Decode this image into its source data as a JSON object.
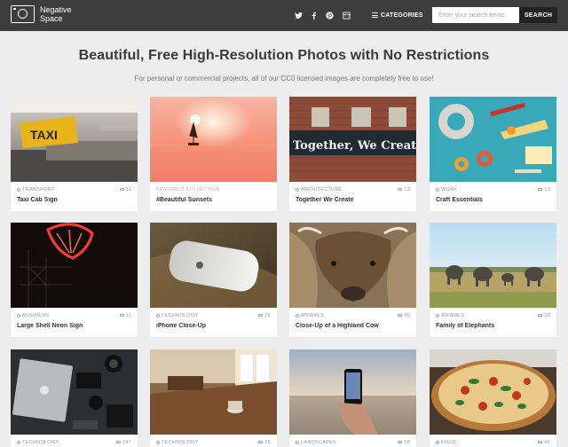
{
  "brand": {
    "name": "Negative Space"
  },
  "nav": {
    "social": [
      "twitter-icon",
      "facebook-icon",
      "pinterest-icon",
      "instagram-icon"
    ],
    "categories_label": "CATEGORIES",
    "search_placeholder": "Enter your search terms",
    "search_button": "SEARCH"
  },
  "hero": {
    "title": "Beautiful, Free High-Resolution Photos with No Restrictions",
    "subtitle": "For personal or commercial projects, all of our CC0 licensed images are completely free to use!"
  },
  "cards": [
    {
      "category": "TRANSPORT",
      "count": "11",
      "title": "Taxi Cab Sign",
      "image": "taxi-sign"
    },
    {
      "category": "FEATURED COLLECTION",
      "count": "",
      "title": "#Beautiful Sunsets",
      "image": "sunset-boat"
    },
    {
      "category": "ARCHITECTURE",
      "count": "13",
      "title": "Together We Create",
      "image": "brick-wall-graffiti"
    },
    {
      "category": "WORK",
      "count": "13",
      "title": "Craft Essentials",
      "image": "craft-tools"
    },
    {
      "category": "BUSINESS",
      "count": "11",
      "title": "Large Shell Neon Sign",
      "image": "neon-sign"
    },
    {
      "category": "TECHNOLOGY",
      "count": "16",
      "title": "iPhone Close-Up",
      "image": "iphone"
    },
    {
      "category": "ANIMALS",
      "count": "49",
      "title": "Close-Up of a Highland Cow",
      "image": "highland-cow"
    },
    {
      "category": "ANIMALS",
      "count": "30",
      "title": "Family of Elephants",
      "image": "elephants"
    },
    {
      "category": "TECHNOLOGY",
      "count": "147",
      "title": "",
      "image": "laptop-desk"
    },
    {
      "category": "TECHNOLOGY",
      "count": "79",
      "title": "",
      "image": "cafe-table"
    },
    {
      "category": "LANDSCAPES",
      "count": "50",
      "title": "",
      "image": "phone-beach"
    },
    {
      "category": "FOOD",
      "count": "46",
      "title": "",
      "image": "pizza"
    }
  ],
  "graffiti_text": "Together, We Create!",
  "taxi_text": "TAXI"
}
